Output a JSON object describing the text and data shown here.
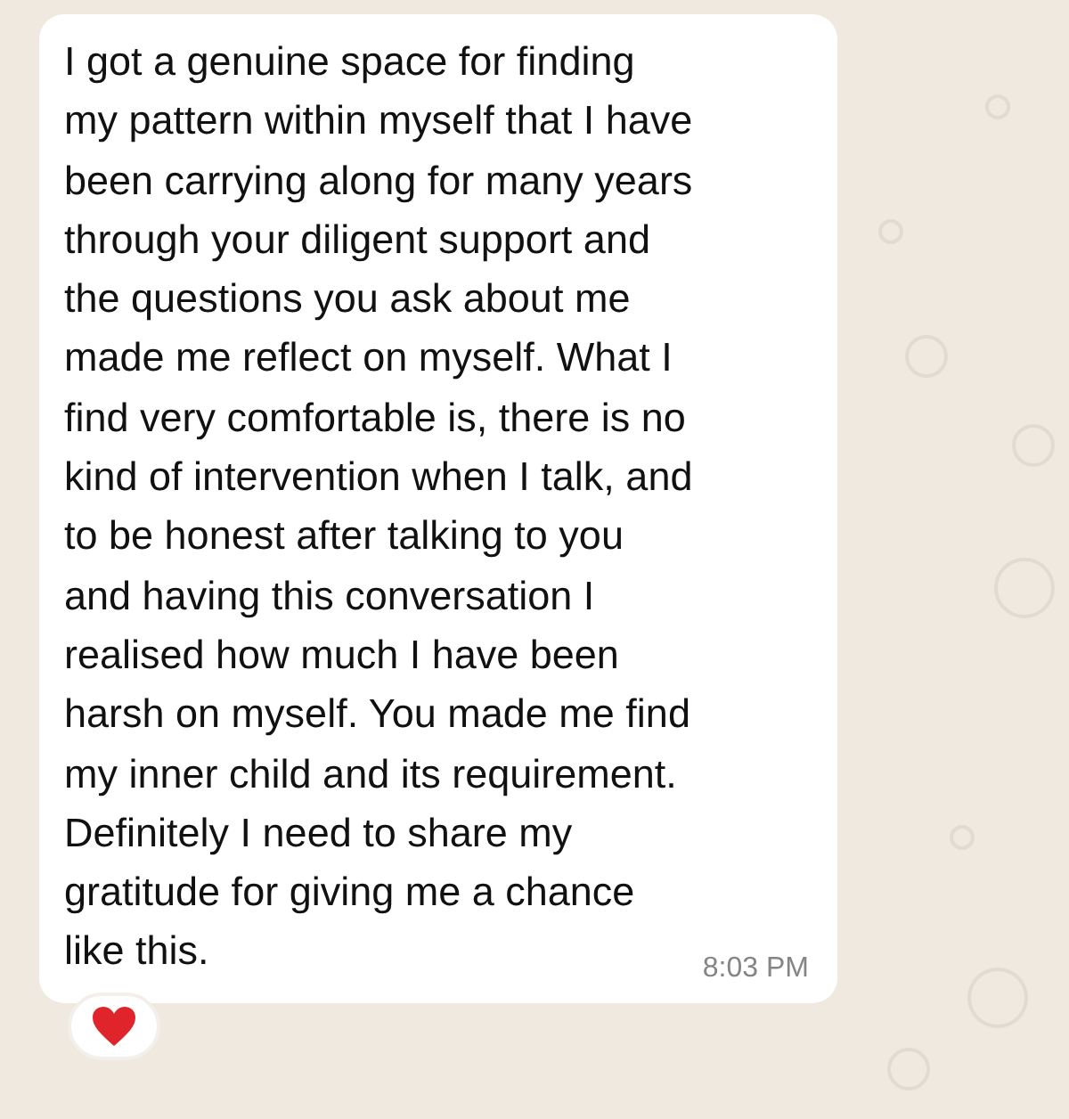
{
  "message": {
    "text": "I got a genuine space for finding\nmy pattern within myself that I have\nbeen carrying along for many years\nthrough your diligent support and\nthe questions you ask about me\nmade me reflect on myself. What I\nfind very comfortable is, there is no\nkind of intervention when I talk, and\nto be honest after talking to you\nand having this conversation I\nrealised how much I have been\nharsh on myself. You made me find\nmy inner child and its requirement.\nDefinitely I need to share my\ngratitude for giving me a chance\nlike this.",
    "time": "8:03 PM",
    "reactions": [
      {
        "kind": "heart"
      }
    ]
  }
}
